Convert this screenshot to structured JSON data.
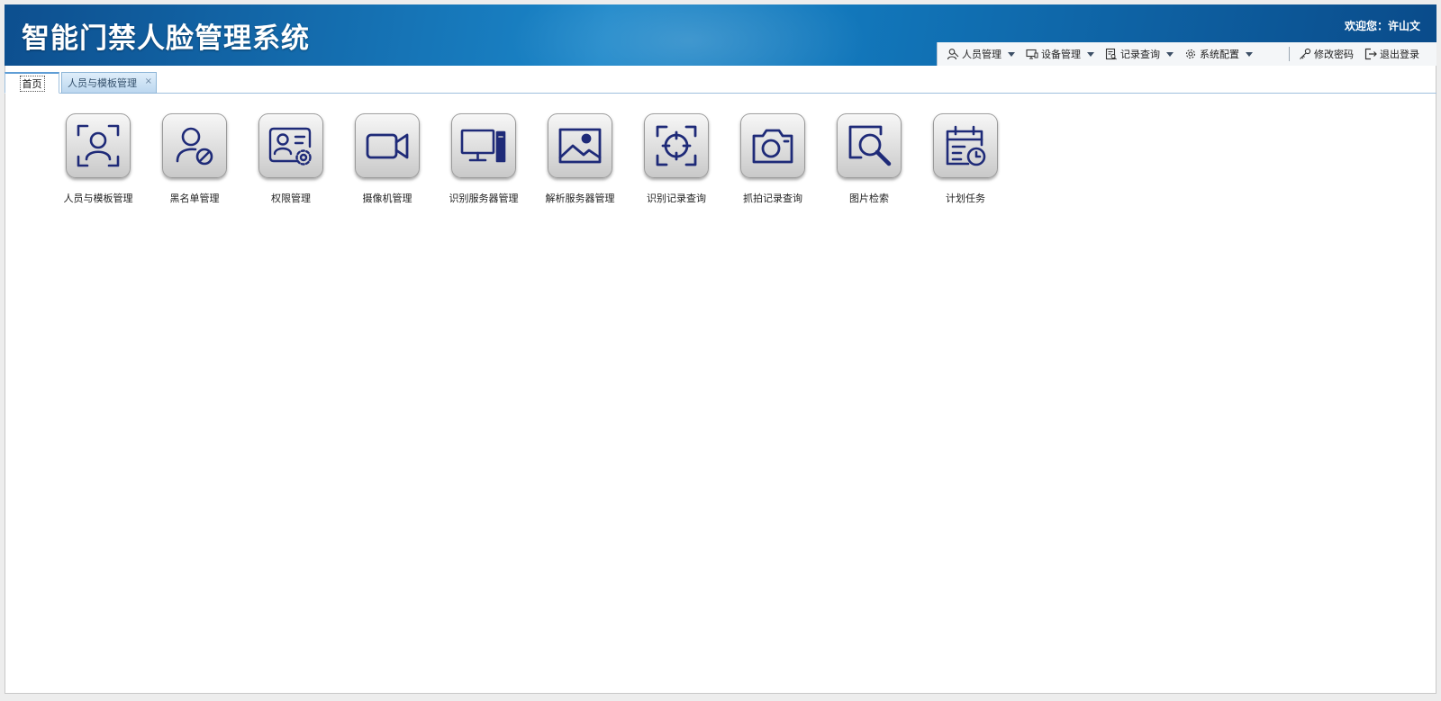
{
  "app": {
    "title": "智能门禁人脸管理系统",
    "welcome": "欢迎您：许山文"
  },
  "menu": {
    "items": [
      {
        "label": "人员管理",
        "icon": "user-icon"
      },
      {
        "label": "设备管理",
        "icon": "device-icon"
      },
      {
        "label": "记录查询",
        "icon": "record-icon"
      },
      {
        "label": "系统配置",
        "icon": "gear-icon"
      }
    ],
    "change_password": "修改密码",
    "logout": "退出登录"
  },
  "tabs": [
    {
      "label": "首页",
      "active": true
    },
    {
      "label": "人员与模板管理",
      "close": "×"
    }
  ],
  "apps": [
    {
      "label": "人员与模板管理",
      "icon": "face-frame-icon"
    },
    {
      "label": "黑名单管理",
      "icon": "user-blocked-icon"
    },
    {
      "label": "权限管理",
      "icon": "id-card-gear-icon"
    },
    {
      "label": "摄像机管理",
      "icon": "video-camera-icon"
    },
    {
      "label": "识别服务器管理",
      "icon": "computer-icon"
    },
    {
      "label": "解析服务器管理",
      "icon": "image-icon"
    },
    {
      "label": "识别记录查询",
      "icon": "focus-target-icon"
    },
    {
      "label": "抓拍记录查询",
      "icon": "camera-icon"
    },
    {
      "label": "图片检索",
      "icon": "image-search-icon"
    },
    {
      "label": "计划任务",
      "icon": "calendar-clock-icon"
    }
  ],
  "colors": {
    "header": "#1278bc",
    "icon": "#1e2a78",
    "tab_border": "#9fc0dd"
  }
}
